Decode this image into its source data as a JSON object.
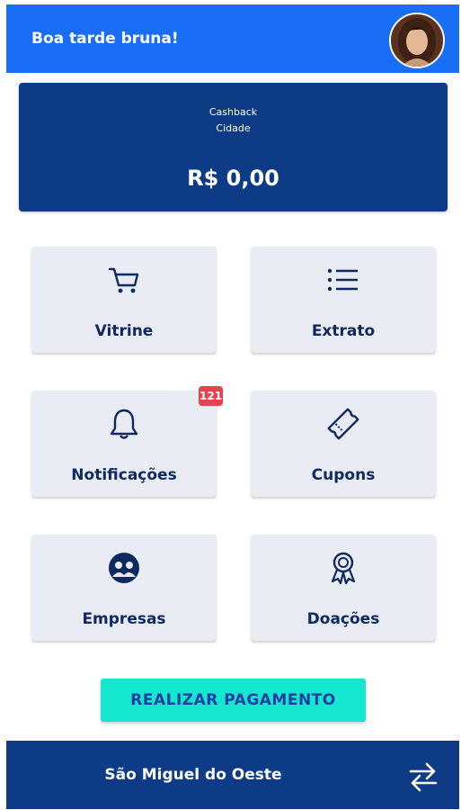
{
  "header": {
    "greeting": "Boa tarde bruna!"
  },
  "cashback": {
    "line1": "Cashback",
    "line2": "Cidade",
    "amount": "R$ 0,00"
  },
  "menu": {
    "tiles": [
      {
        "label": "Vitrine",
        "icon": "shopping-cart-icon"
      },
      {
        "label": "Extrato",
        "icon": "list-icon"
      },
      {
        "label": "Notificações",
        "icon": "bell-icon",
        "badge": "121"
      },
      {
        "label": "Cupons",
        "icon": "ticket-icon"
      },
      {
        "label": "Empresas",
        "icon": "people-group-icon"
      },
      {
        "label": "Doações",
        "icon": "award-ribbon-icon"
      }
    ]
  },
  "actions": {
    "pay_label": "REALIZAR PAGAMENTO"
  },
  "footer": {
    "city": "São Miguel do Oeste",
    "icon": "swap-arrows-icon"
  },
  "colors": {
    "header": "#1a6ef5",
    "card": "#0d3b86",
    "tile": "#e9ecf2",
    "accent": "#15e6cf",
    "badge": "#e8424f",
    "text": "#0f2a60"
  }
}
